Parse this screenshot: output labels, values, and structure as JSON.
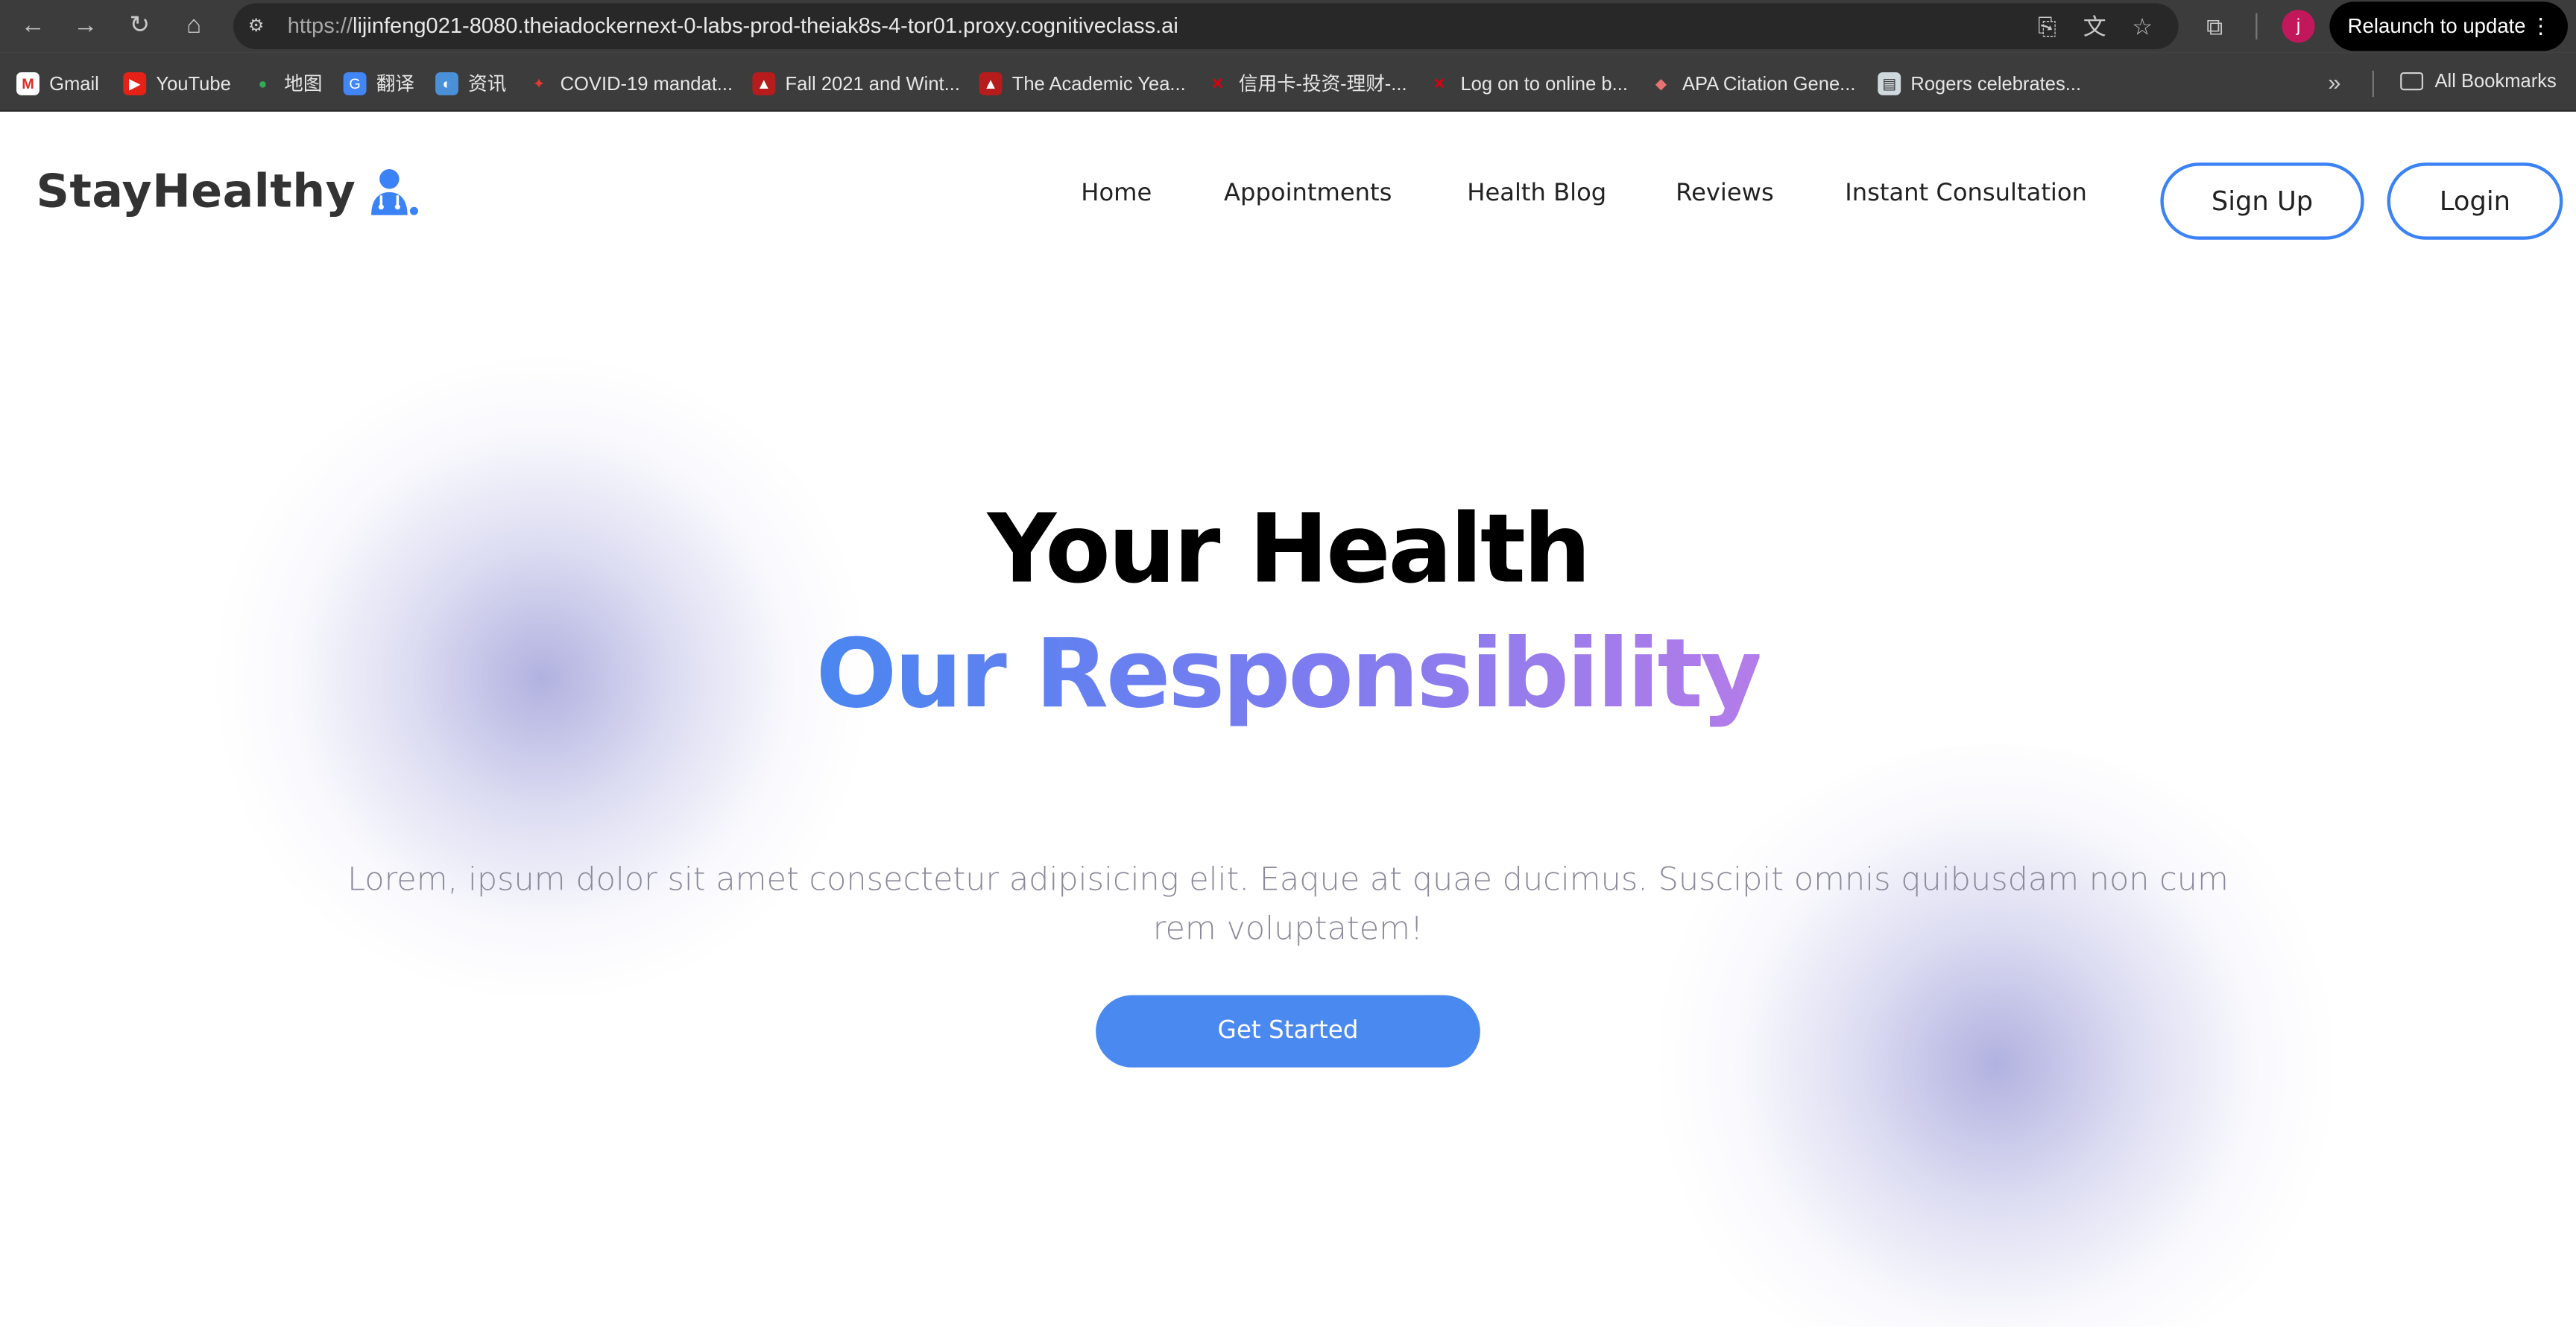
{
  "browser": {
    "url_scheme": "https://",
    "url_host": "lijinfeng021-8080.theiadockernext-0-labs-prod-theiak8s-4-tor01.proxy.cognitiveclass.ai",
    "profile_initial": "j",
    "relaunch_label": "Relaunch to update",
    "bookmarks": [
      {
        "label": "Gmail",
        "icon": "gmail-icon"
      },
      {
        "label": "YouTube",
        "icon": "youtube-icon"
      },
      {
        "label": "地图",
        "icon": "maps-icon"
      },
      {
        "label": "翻译",
        "icon": "translate-icon"
      },
      {
        "label": "资讯",
        "icon": "news-icon"
      },
      {
        "label": "COVID-19 mandat...",
        "icon": "maple-leaf-icon"
      },
      {
        "label": "Fall 2021 and Wint...",
        "icon": "university-icon"
      },
      {
        "label": "The Academic Yea...",
        "icon": "university-icon"
      },
      {
        "label": "信用卡-投资-理财-...",
        "icon": "hsbc-icon"
      },
      {
        "label": "Log on to online b...",
        "icon": "hsbc-icon"
      },
      {
        "label": "APA Citation Gene...",
        "icon": "citation-icon"
      },
      {
        "label": "Rogers celebrates...",
        "icon": "page-icon"
      }
    ],
    "all_bookmarks_label": "All Bookmarks"
  },
  "site": {
    "brand": "StayHealthy",
    "nav": {
      "home": "Home",
      "appointments": "Appointments",
      "health_blog": "Health Blog",
      "reviews": "Reviews",
      "instant_consultation": "Instant Consultation"
    },
    "sign_up": "Sign Up",
    "login": "Login",
    "hero_line1": "Your Health",
    "hero_line2": "Our Responsibility",
    "subtitle": "Lorem, ipsum dolor sit amet consectetur adipisicing elit. Eaque at quae ducimus. Suscipit omnis quibusdam non cum rem voluptatem!",
    "cta": "Get Started"
  },
  "colors": {
    "accent": "#3b82f6",
    "cta_bg": "#4a8af0",
    "gradient_start": "#4a86f0",
    "gradient_end": "#b47ce9"
  }
}
